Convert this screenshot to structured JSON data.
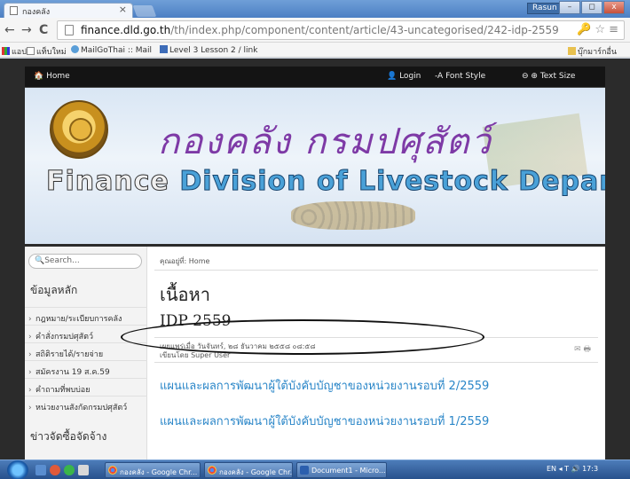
{
  "browser": {
    "tab_title": "กองคลัง",
    "tab_close": "×",
    "user_badge": "Rasun",
    "window_buttons": [
      "–",
      "◻",
      "x"
    ],
    "nav": {
      "back": "←",
      "forward": "→",
      "reload": "C"
    },
    "url_host": "finance.dld.go.th",
    "url_path": "/th/index.php/component/content/article/43-uncategorised/242-idp-2559",
    "omni_right": "🔑 ☆ ≡",
    "bookmarks": [
      {
        "label": "แอป",
        "icon": "apps-icon"
      },
      {
        "label": "แท็บใหม่",
        "icon": "page-icon"
      },
      {
        "label": "MailGoThai :: Mail",
        "icon": "mail-icon"
      },
      {
        "label": "Level 3 Lesson 2 / link",
        "icon": "lesson-icon"
      }
    ],
    "other_bookmarks": "บุ๊กมาร์กอื่น"
  },
  "site": {
    "nav": {
      "home": "Home",
      "login": "Login",
      "font_style": "Font Style",
      "text_size": "Text Size"
    },
    "banner": {
      "thai_title": "กองคลัง กรมปศุสัตว์",
      "en_first": "Finance",
      "en_rest": " Division of Livestock Department"
    },
    "sidebar": {
      "search_placeholder": "Search...",
      "heading1": "ข้อมูลหลัก",
      "items": [
        "กฎหมาย/ระเบียบการคลัง",
        "คำสั่งกรมปศุสัตว์",
        "สถิติรายได้/รายจ่าย",
        "สมัครงาน 19 ส.ค.59",
        "คำถามที่พบบ่อย",
        "หน่วยงานสังกัดกรมปศุสัตว์"
      ],
      "heading2": "ข่าวจัดซื้อจัดจ้าง"
    },
    "main": {
      "breadcrumb": "คุณอยู่ที่: Home",
      "title": "เนื้อหา",
      "article_title": "IDP 2559",
      "published": "เผยแพร่เมื่อ วันจันทร์, ๒๘ ธันวาคม ๒๕๕๘ ๐๘:๕๘",
      "author": "เขียนโดย Super User",
      "meta_icons": "✉ 🖶",
      "links": [
        "แผนและผลการพัฒนาผู้ใต้บังคับบัญชาของหน่วยงานรอบที่ 2/2559",
        "แผนและผลการพัฒนาผู้ใต้บังคับบัญชาของหน่วยงานรอบที่ 1/2559"
      ]
    }
  },
  "taskbar": {
    "tasks": [
      "กองคลัง - Google Chr...",
      "กองคลัง - Google Chr...",
      "Document1 - Micro..."
    ],
    "tray": "EN  ◂  T  🔊 17:3"
  }
}
